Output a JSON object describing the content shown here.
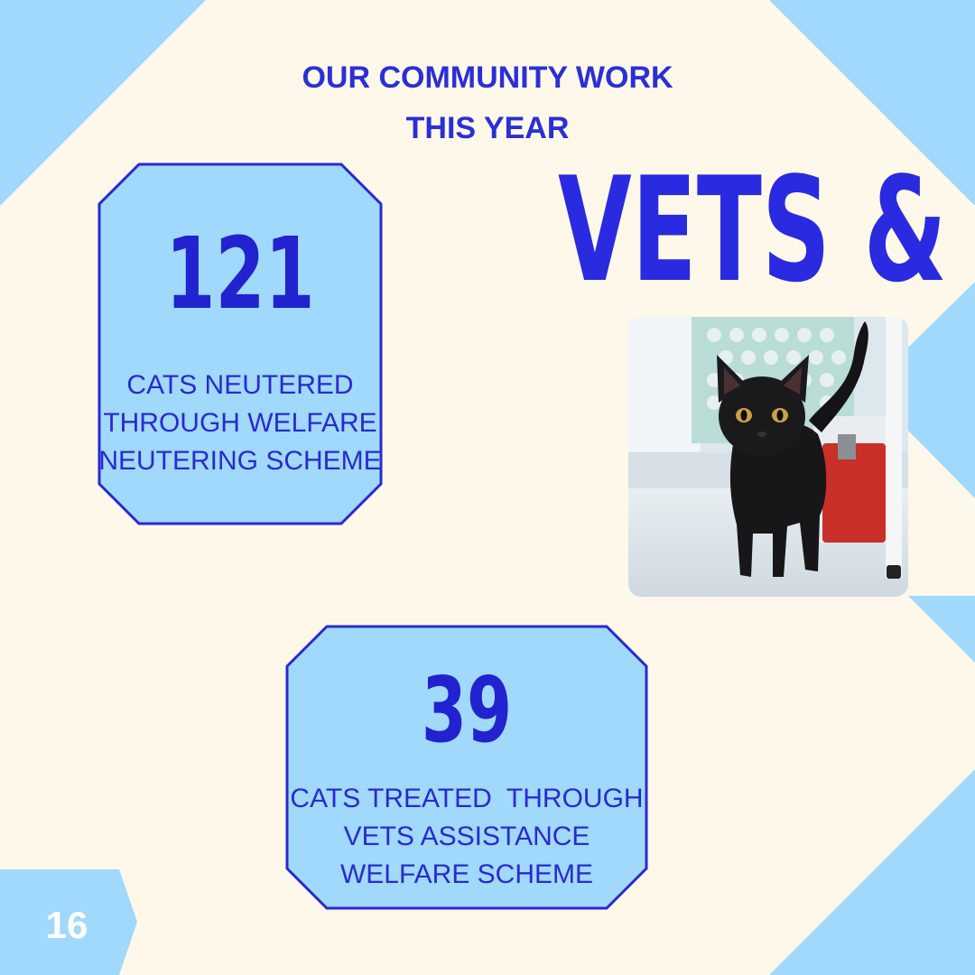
{
  "heading": {
    "line1": "OUR COMMUNITY WORK",
    "line2": "THIS YEAR"
  },
  "big_title": "VETS &",
  "stats": [
    {
      "number": "121",
      "description_lines": [
        "CATS NEUTERED",
        "THROUGH WELFARE",
        "NEUTERING SCHEME"
      ]
    },
    {
      "number": "39",
      "description_lines": [
        "CATS TREATED  THROUGH",
        "VETS ASSISTANCE",
        "WELFARE SCHEME"
      ]
    }
  ],
  "page_number": "16",
  "colors": {
    "background": "#fdf8ea",
    "accent_light_blue": "#a0d9fb",
    "text_blue": "#2a2ae0",
    "white": "#ffffff"
  }
}
